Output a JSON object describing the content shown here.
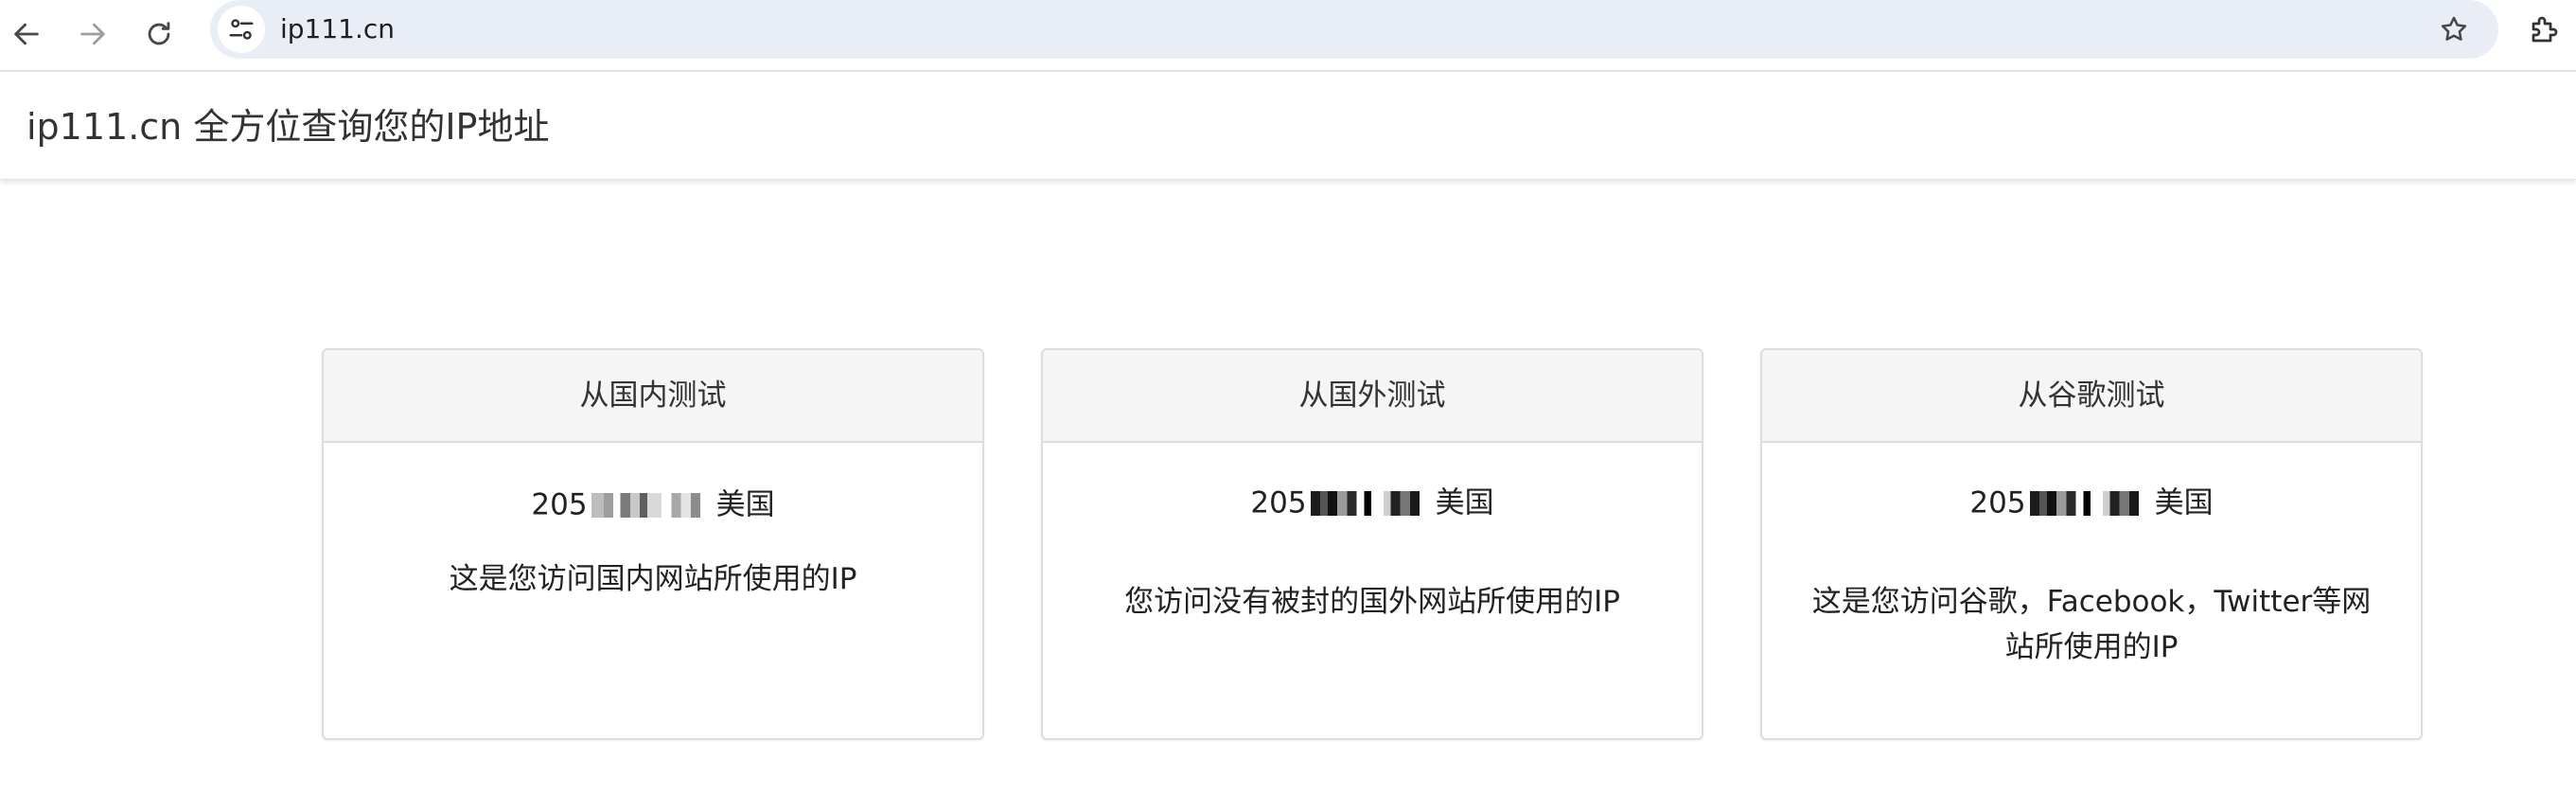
{
  "browser": {
    "url": "ip111.cn",
    "icons": {
      "back": "back-arrow-icon",
      "forward": "forward-arrow-icon",
      "reload": "reload-icon",
      "site_info": "tune-icon",
      "bookmark": "star-icon",
      "extensions": "puzzle-icon"
    }
  },
  "header": {
    "title": "ip111.cn 全方位查询您的IP地址"
  },
  "panels": [
    {
      "heading": "从国内测试",
      "ip_prefix": "205",
      "country": "美国",
      "description": "这是您访问国内网站所使用的IP"
    },
    {
      "heading": "从国外测试",
      "ip_prefix": "205",
      "country": "美国",
      "description": "您访问没有被封的国外网站所使用的IP"
    },
    {
      "heading": "从谷歌测试",
      "ip_prefix": "205",
      "country": "美国",
      "description": "这是您访问谷歌，Facebook，Twitter等网站所使用的IP"
    }
  ],
  "colors": {
    "panel_heading_bg": "#f5f5f5",
    "panel_border": "#dddddd",
    "omnibox_bg": "#e9eef6"
  }
}
